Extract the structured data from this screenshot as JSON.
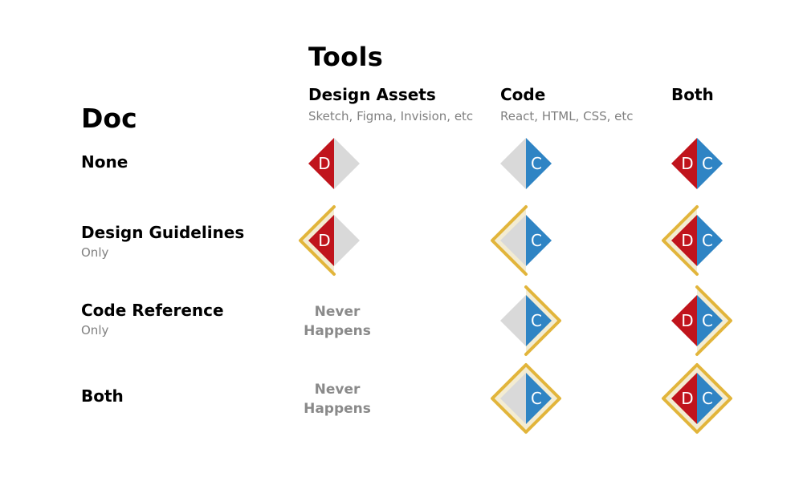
{
  "title_tools": "Tools",
  "title_doc": "Doc",
  "columns": [
    {
      "label": "Design Assets",
      "sublabel": "Sketch, Figma, Invision, etc"
    },
    {
      "label": "Code",
      "sublabel": "React, HTML, CSS, etc"
    },
    {
      "label": "Both",
      "sublabel": ""
    }
  ],
  "rows": [
    {
      "label": "None",
      "sublabel": ""
    },
    {
      "label": "Design Guidelines",
      "sublabel": "Only"
    },
    {
      "label": "Code Reference",
      "sublabel": "Only"
    },
    {
      "label": "Both",
      "sublabel": ""
    }
  ],
  "never_happens": [
    "Never",
    "Happens"
  ],
  "badges": {
    "design_letter": "D",
    "code_letter": "C",
    "grid": [
      [
        "D",
        "C",
        "DC"
      ],
      [
        "D+guide",
        "C+guide",
        "DC+guide"
      ],
      [
        "never",
        "C+code",
        "DC+code"
      ],
      [
        "never",
        "C+both",
        "DC+both"
      ]
    ]
  },
  "colors": {
    "design": "#c0141c",
    "code": "#2f84c4",
    "empty": "#d9d9d9",
    "frame": "#e2b53b",
    "frame_fill": "#f3ecd3",
    "muted_text": "#808080"
  }
}
